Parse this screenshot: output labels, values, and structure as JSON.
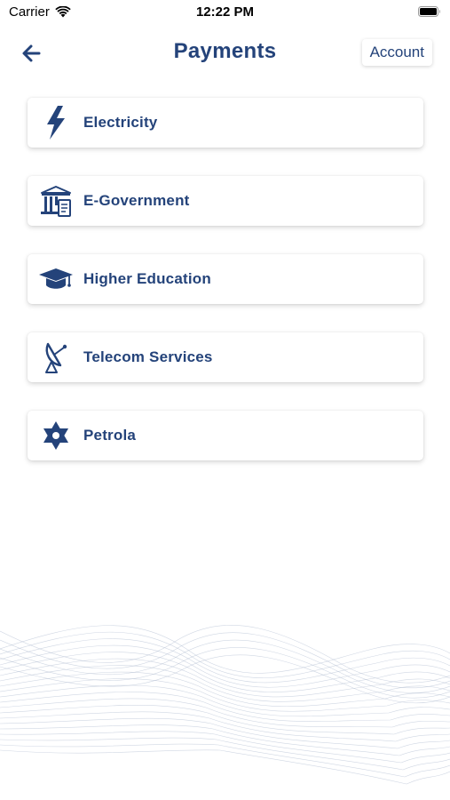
{
  "status_bar": {
    "carrier": "Carrier",
    "time": "12:22 PM"
  },
  "nav": {
    "title": "Payments",
    "account_label": "Account"
  },
  "colors": {
    "accent": "#24437a"
  },
  "services": [
    {
      "label": "Electricity",
      "icon": "lightning-bolt-icon"
    },
    {
      "label": "E-Government",
      "icon": "government-building-icon"
    },
    {
      "label": "Higher Education",
      "icon": "graduation-cap-icon"
    },
    {
      "label": "Telecom Services",
      "icon": "satellite-dish-icon"
    },
    {
      "label": "Petrola",
      "icon": "star-of-david-icon"
    }
  ]
}
